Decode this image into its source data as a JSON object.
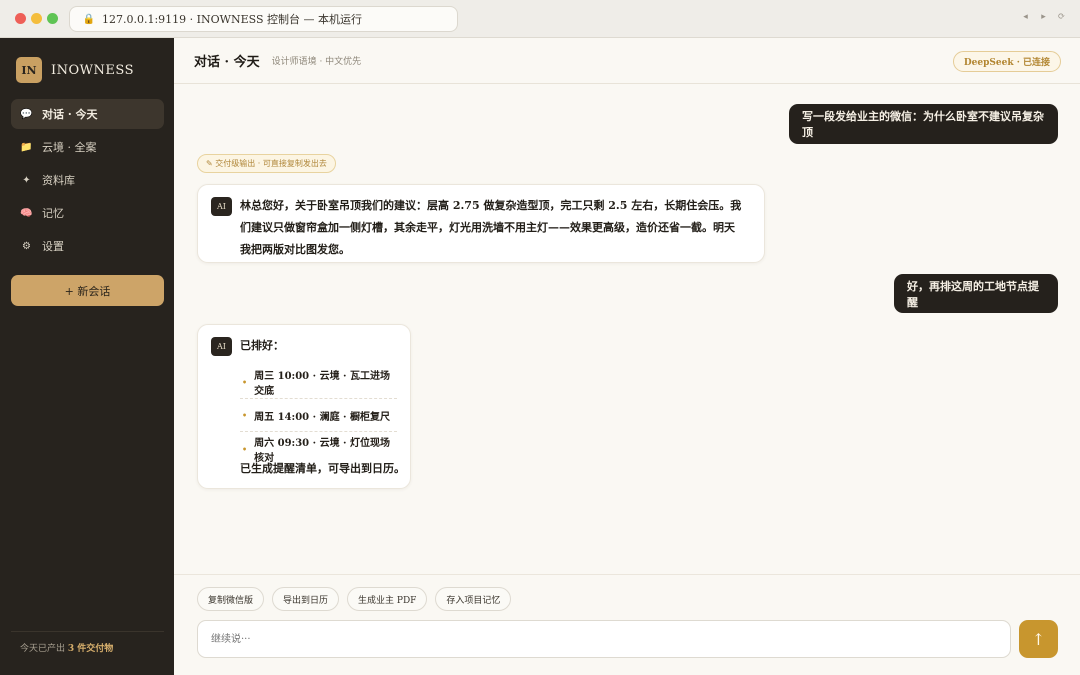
{
  "browser": {
    "url": "127.0.0.1:9119 · INOWNESS 控制台 — 本机运行",
    "lock_icon": "lock-icon",
    "nav_back": "◂",
    "nav_forward": "▸",
    "nav_reload": "⟳"
  },
  "sidebar": {
    "logo": "IN",
    "brand": "INOWNESS",
    "items": [
      {
        "label": "对话 · 今天",
        "icon": "💬",
        "active": true
      },
      {
        "label": "云境 · 全案",
        "icon": "📁",
        "active": false
      },
      {
        "label": "资料库",
        "icon": "✦",
        "active": false
      },
      {
        "label": "记忆",
        "icon": "🧠",
        "active": false
      },
      {
        "label": "设置",
        "icon": "⚙",
        "active": false
      }
    ],
    "new_button": "+ 新会话",
    "footer_prefix": "今天已产出",
    "footer_count": "3 件交付物"
  },
  "header": {
    "title": "对话 · 今天",
    "subtitle": "设计师语境 · 中文优先",
    "status": "DeepSeek · 已连接"
  },
  "messages": {
    "user_1": "写一段发给业主的微信：为什么卧室不建议吊复杂顶",
    "deliver_tag": "✎ 交付级输出 · 可直接复制发出去",
    "ai_badge": "AI",
    "ai_1": "林总您好，关于卧室吊顶我们的建议：层高 2.75 做复杂造型顶，完工只剩 2.5 左右，长期住会压。我们建议只做窗帘盒加一侧灯槽，其余走平，灯光用洗墙不用主灯——效果更高级，造价还省一截。明天我把两版对比图发您。",
    "user_2": "好，再排这周的工地节点提醒",
    "ai_2_intro": "已排好：",
    "schedule": [
      "周三 10:00 · 云境 · 瓦工进场交底",
      "周五 14:00 · 澜庭 · 橱柜复尺",
      "周六 09:30 · 云境 · 灯位现场核对"
    ],
    "ai_2_footer": "已生成提醒清单，可导出到日历。"
  },
  "composer": {
    "chips": [
      "复制微信版",
      "导出到日历",
      "生成业主 PDF",
      "存入项目记忆"
    ],
    "placeholder": "继续说···",
    "send_icon": "↑"
  }
}
